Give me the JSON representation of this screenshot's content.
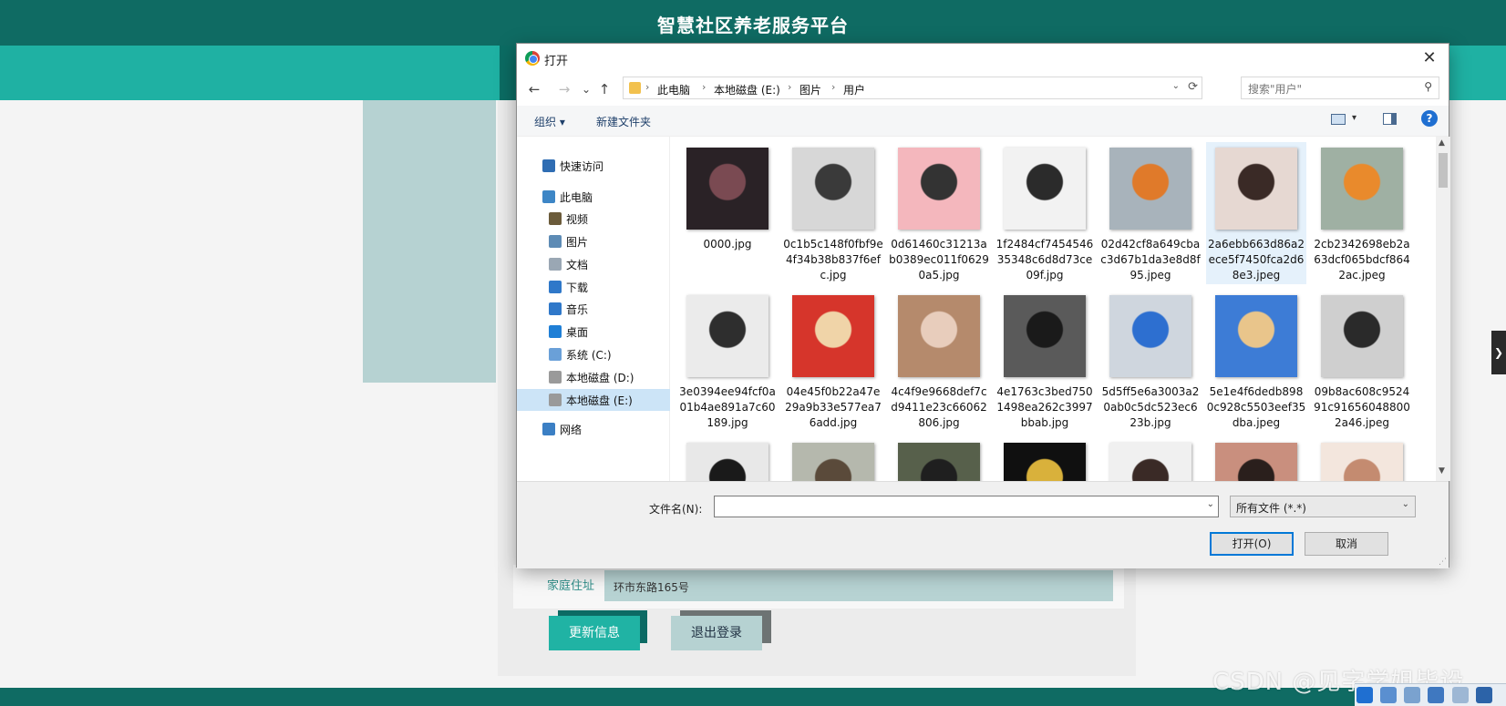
{
  "page": {
    "title": "智慧社区养老服务平台",
    "address_label": "家庭住址",
    "address_value": "环市东路165号",
    "update_button": "更新信息",
    "logout_button": "退出登录",
    "right_tab_glyph": "❯",
    "watermark": "CSDN @见字学姐毕设"
  },
  "dialog": {
    "title": "打开",
    "close_glyph": "✕",
    "nav": {
      "back": "←",
      "forward": "→",
      "recent": "⌄",
      "up": "↑"
    },
    "breadcrumb": [
      "此电脑",
      "本地磁盘 (E:)",
      "图片",
      "用户"
    ],
    "breadcrumb_separator": "›",
    "search_placeholder": "搜索\"用户\"",
    "toolbar": {
      "organize": "组织 ▾",
      "new_folder": "新建文件夹",
      "help": "?"
    },
    "sidebar": [
      {
        "label": "快速访问",
        "icon": "star-icon",
        "color": "#2f6db3"
      },
      {
        "label": "此电脑",
        "icon": "computer-icon",
        "color": "#3d86c6"
      },
      {
        "label": "视频",
        "icon": "video-icon",
        "color": "#6b5b3a"
      },
      {
        "label": "图片",
        "icon": "pictures-icon",
        "color": "#5d8bb5"
      },
      {
        "label": "文档",
        "icon": "documents-icon",
        "color": "#9aa7b4"
      },
      {
        "label": "下载",
        "icon": "download-icon",
        "color": "#2f78c9"
      },
      {
        "label": "音乐",
        "icon": "music-icon",
        "color": "#2f78c9"
      },
      {
        "label": "桌面",
        "icon": "desktop-icon",
        "color": "#1f7fd6"
      },
      {
        "label": "系统 (C:)",
        "icon": "system-drive-icon",
        "color": "#6aa0d8"
      },
      {
        "label": "本地磁盘 (D:)",
        "icon": "drive-icon",
        "color": "#9a9a9a"
      },
      {
        "label": "本地磁盘 (E:)",
        "icon": "drive-icon",
        "color": "#9a9a9a",
        "selected": true
      },
      {
        "label": "网络",
        "icon": "network-icon",
        "color": "#3b7fc4"
      }
    ],
    "files": [
      {
        "name": "0000.jpg",
        "thumb": [
          "#2a2226",
          "#7a4a52"
        ]
      },
      {
        "name": "0c1b5c148f0fbf9e4f34b38b837f6efc.jpg",
        "thumb": [
          "#d7d7d7",
          "#3a3a3a"
        ]
      },
      {
        "name": "0d61460c31213ab0389ec011f06290a5.jpg",
        "thumb": [
          "#f4b7bd",
          "#333333"
        ]
      },
      {
        "name": "1f2484cf745454635348c6d8d73ce09f.jpg",
        "thumb": [
          "#f2f2f2",
          "#2b2b2b"
        ]
      },
      {
        "name": "02d42cf8a649cbac3d67b1da3e8d8f95.jpeg",
        "thumb": [
          "#a8b3bb",
          "#e07a2a"
        ]
      },
      {
        "name": "2a6ebb663d86a2ece5f7450fca2d68e3.jpeg",
        "thumb": [
          "#e6d8d2",
          "#3a2a26"
        ],
        "hover": true
      },
      {
        "name": "2cb2342698eb2a63dcf065bdcf8642ac.jpeg",
        "thumb": [
          "#9fb0a3",
          "#e98a2c"
        ]
      },
      {
        "name": "3e0394ee94fcf0a01b4ae891a7c60189.jpg",
        "thumb": [
          "#ebebeb",
          "#2e2e2e"
        ]
      },
      {
        "name": "04e45f0b22a47e29a9b33e577ea76add.jpg",
        "thumb": [
          "#d6352b",
          "#f0d4a8"
        ]
      },
      {
        "name": "4c4f9e9668def7cd9411e23c66062806.jpg",
        "thumb": [
          "#b58a6c",
          "#e8cdbc"
        ]
      },
      {
        "name": "4e1763c3bed7501498ea262c3997bbab.jpg",
        "thumb": [
          "#5a5a5a",
          "#1a1a1a"
        ]
      },
      {
        "name": "5d5ff5e6a3003a20ab0c5dc523ec623b.jpg",
        "thumb": [
          "#cfd6de",
          "#2d6fd0"
        ]
      },
      {
        "name": "5e1e4f6dedb8980c928c5503eef35dba.jpeg",
        "thumb": [
          "#3d7cd6",
          "#e9c58b"
        ]
      },
      {
        "name": "09b8ac608c952491c916560488002a46.jpeg",
        "thumb": [
          "#cfcfcf",
          "#2a2a2a"
        ]
      },
      {
        "name": "",
        "thumb": [
          "#e8e8e8",
          "#1a1a1a"
        ]
      },
      {
        "name": "",
        "thumb": [
          "#b5b8ad",
          "#5a4a3a"
        ]
      },
      {
        "name": "",
        "thumb": [
          "#57604b",
          "#1f1f1f"
        ]
      },
      {
        "name": "",
        "thumb": [
          "#101010",
          "#d9b13b"
        ]
      },
      {
        "name": "",
        "thumb": [
          "#f0f0f0",
          "#3a2a26"
        ]
      },
      {
        "name": "",
        "thumb": [
          "#c98f7e",
          "#2a1f1c"
        ]
      },
      {
        "name": "",
        "thumb": [
          "#f3e6dd",
          "#c48b70"
        ]
      }
    ],
    "filename_label": "文件名(N):",
    "filename_value": "",
    "filetype_value": "所有文件 (*.*)",
    "open_button": "打开(O)",
    "cancel_button": "取消"
  }
}
